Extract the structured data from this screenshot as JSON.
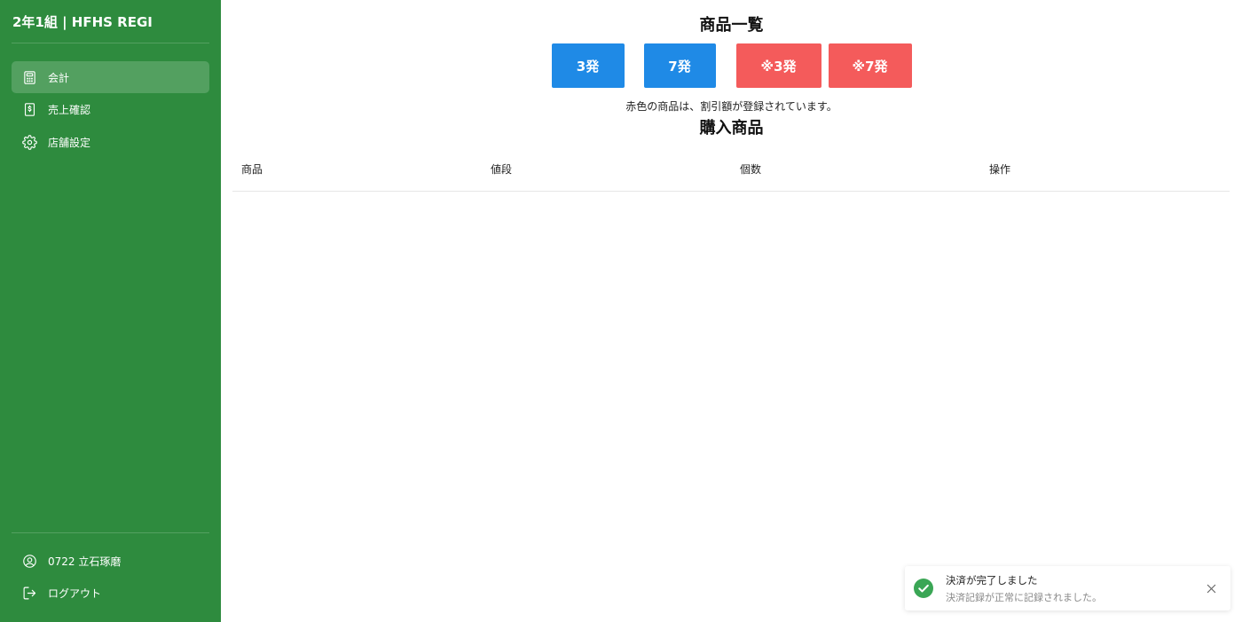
{
  "app": {
    "brand": "2年1組 | HFHS REGI"
  },
  "sidebar": {
    "items": [
      {
        "label": "会計",
        "icon": "calculator-icon",
        "active": true
      },
      {
        "label": "売上確認",
        "icon": "receipt-dollar-icon",
        "active": false
      },
      {
        "label": "店舗設定",
        "icon": "gear-icon",
        "active": false
      }
    ],
    "footer": {
      "user_label": "0722 立石琢磨",
      "user_icon": "user-circle-icon",
      "logout_label": "ログアウト",
      "logout_icon": "logout-icon"
    }
  },
  "products": {
    "title": "商品一覧",
    "buttons": [
      {
        "label": "3発",
        "color": "#1f8ae6"
      },
      {
        "label": "7発",
        "color": "#1f8ae6"
      },
      {
        "label": "※3発",
        "color": "#f45b5b"
      },
      {
        "label": "※7発",
        "color": "#f45b5b"
      }
    ],
    "note": "赤色の商品は、割引額が登録されています。"
  },
  "cart": {
    "title": "購入商品",
    "columns": [
      "商品",
      "値段",
      "個数",
      "操作"
    ],
    "rows": []
  },
  "toast": {
    "title": "決済が完了しました",
    "description": "決済記録が正常に記録されました。",
    "icon": "check-circle-icon",
    "close_icon": "close-icon"
  },
  "colors": {
    "sidebar": "#2e8b3e",
    "primary_button": "#1f8ae6",
    "discount_button": "#f45b5b",
    "success": "#3aa655"
  }
}
